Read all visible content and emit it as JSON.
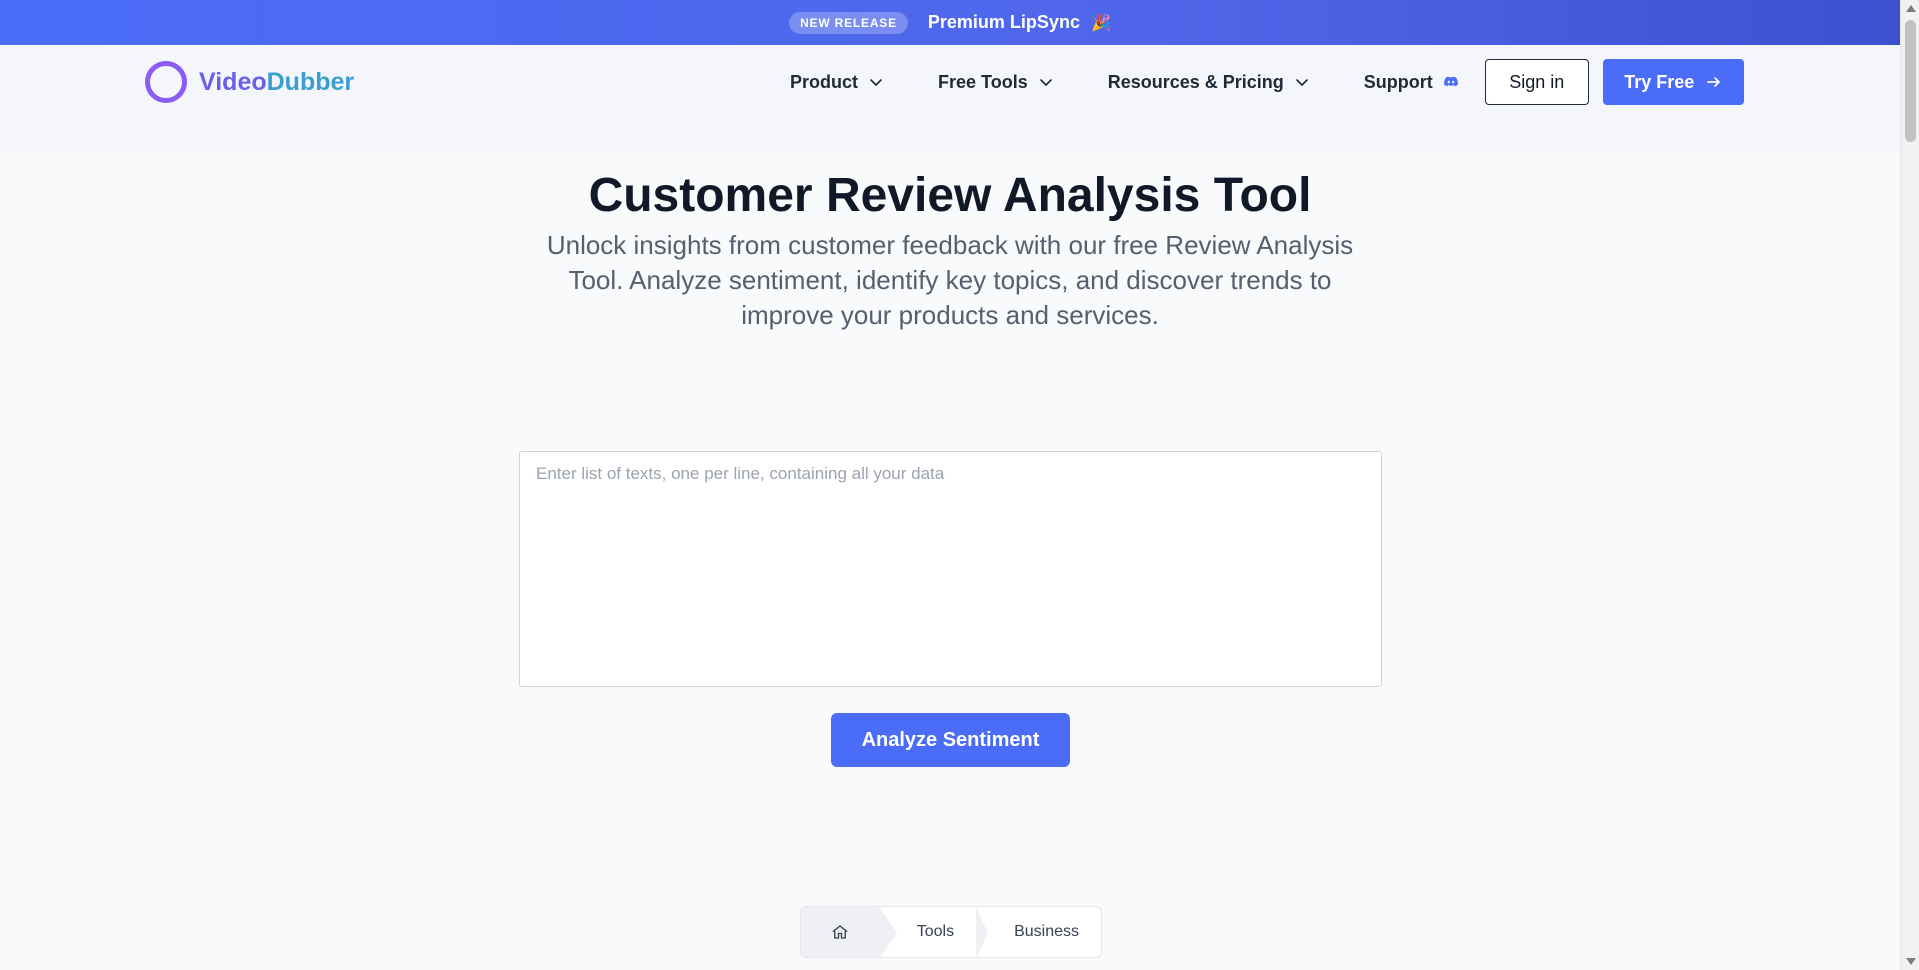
{
  "announcement": {
    "badge": "NEW RELEASE",
    "text": "Premium LipSync",
    "emoji": "🎉"
  },
  "brand": {
    "name_part1": "Video",
    "name_part2": "Dubber",
    "ring_color": "#8b5cf6"
  },
  "nav": {
    "items": [
      {
        "label": "Product",
        "icon": "chevron-down-icon"
      },
      {
        "label": "Free Tools",
        "icon": "chevron-down-icon"
      },
      {
        "label": "Resources & Pricing",
        "icon": "chevron-down-icon"
      },
      {
        "label": "Support",
        "icon": "discord-icon"
      }
    ],
    "signin_label": "Sign in",
    "try_label": "Try Free",
    "try_icon": "arrow-right-icon"
  },
  "hero": {
    "title": "Customer Review Analysis Tool",
    "subtitle": "Unlock insights from customer feedback with our free Review Analysis Tool. Analyze sentiment, identify key topics, and discover trends to improve your products and services."
  },
  "analyzer": {
    "placeholder": "Enter list of texts, one per line, containing all your data",
    "value": "",
    "button_label": "Analyze Sentiment"
  },
  "breadcrumb": {
    "home_icon": "home-icon",
    "items": [
      "Tools",
      "Business"
    ]
  },
  "colors": {
    "accent": "#4a6cf7",
    "text_dark": "#111827",
    "text_muted": "#555f6d"
  }
}
